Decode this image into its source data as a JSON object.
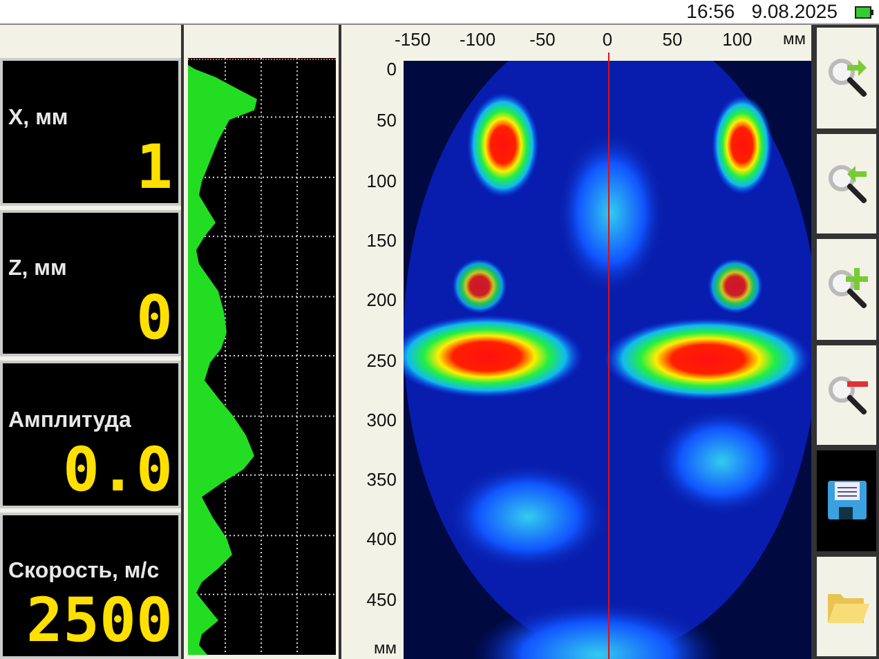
{
  "status_bar": {
    "time": "16:56",
    "date": "9.08.2025"
  },
  "readouts": [
    {
      "label": "X, мм",
      "value": "1"
    },
    {
      "label": "Z, мм",
      "value": "0"
    },
    {
      "label": "Амплитуда",
      "value": "0.0"
    },
    {
      "label": "Скорость, м/с",
      "value": "2500"
    }
  ],
  "bscan": {
    "x_ticks": [
      "-150",
      "-100",
      "-50",
      "0",
      "50",
      "100"
    ],
    "x_unit": "мм",
    "y_ticks": [
      "0",
      "50",
      "100",
      "150",
      "200",
      "250",
      "300",
      "350",
      "400",
      "450"
    ],
    "y_unit": "мм"
  },
  "toolbar": [
    {
      "kind": "zoom-right",
      "selected": false
    },
    {
      "kind": "zoom-left",
      "selected": false
    },
    {
      "kind": "zoom-in",
      "selected": false
    },
    {
      "kind": "zoom-out",
      "selected": false
    },
    {
      "kind": "save",
      "selected": true
    },
    {
      "kind": "open",
      "selected": false
    }
  ]
}
